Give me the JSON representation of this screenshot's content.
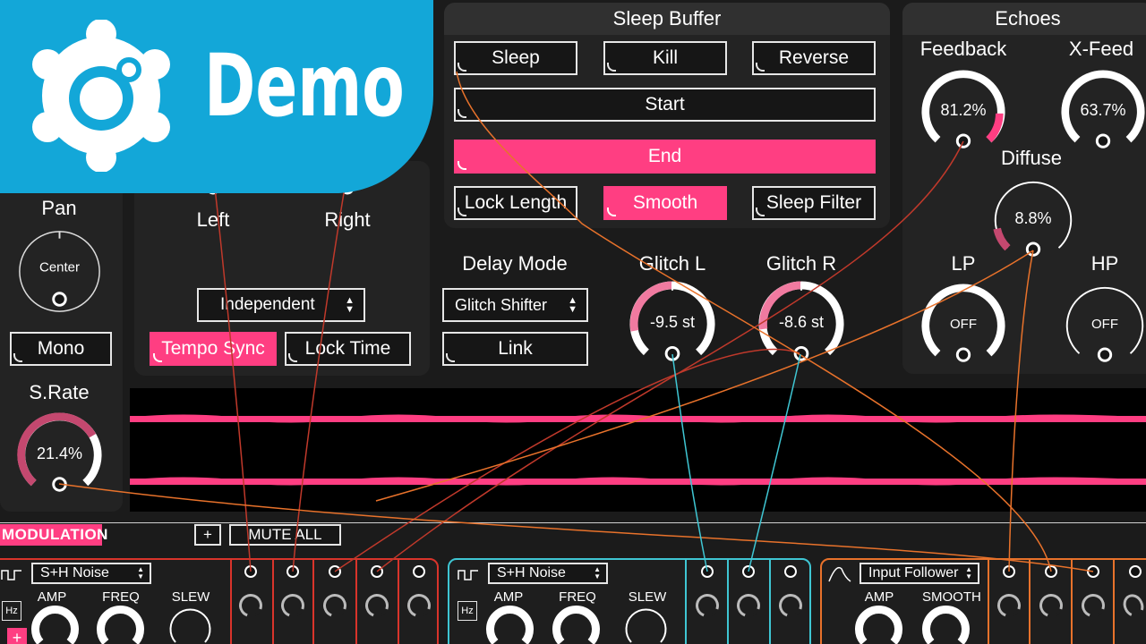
{
  "logo": {
    "text": "Demo"
  },
  "left_column": {
    "pan_label": "Pan",
    "pan_value": "Center",
    "mono": "Mono",
    "srate_label": "S.Rate",
    "srate_value": "21.4%",
    "srate_level": 0.214
  },
  "delay": {
    "left": "Left",
    "right": "Right",
    "mode_select": "Independent",
    "tempo_sync": "Tempo Sync",
    "lock_time": "Lock Time"
  },
  "sleep_buffer": {
    "title": "Sleep Buffer",
    "sleep": "Sleep",
    "kill": "Kill",
    "reverse": "Reverse",
    "start": "Start",
    "end": "End",
    "lock_length": "Lock Length",
    "smooth": "Smooth",
    "sleep_filter": "Sleep Filter"
  },
  "delay_mode": {
    "label": "Delay Mode",
    "select": "Glitch Shifter",
    "link": "Link"
  },
  "glitch": {
    "left_label": "Glitch L",
    "left_value": "-9.5 st",
    "right_label": "Glitch R",
    "right_value": "-8.6 st"
  },
  "echoes": {
    "title": "Echoes",
    "feedback_label": "Feedback",
    "feedback_value": "81.2%",
    "xfeed_label": "X-Feed",
    "xfeed_value": "63.7%",
    "diffuse_label": "Diffuse",
    "diffuse_value": "8.8%",
    "lp_label": "LP",
    "lp_value": "OFF",
    "hp_label": "HP",
    "hp_value": "OFF"
  },
  "modulation": {
    "title": "MODULATION",
    "add": "+",
    "mute_all": "MUTE ALL",
    "cards": [
      {
        "type": "S+H Noise",
        "amp": "AMP",
        "freq": "FREQ",
        "slew": "SLEW",
        "hz": "Hz",
        "plus": "+",
        "color": "#d9342b"
      },
      {
        "type": "S+H Noise",
        "amp": "AMP",
        "freq": "FREQ",
        "slew": "SLEW",
        "hz": "Hz",
        "color": "#3fc6d3"
      },
      {
        "type": "Input Follower",
        "amp": "AMP",
        "smooth": "SMOOTH",
        "color": "#e8722b"
      }
    ]
  },
  "colors": {
    "accent": "#ff3e82",
    "logo": "#13a7d8",
    "cable_red": "#c0392b",
    "cable_orange": "#e8722b",
    "cable_cyan": "#3fc6d3"
  }
}
